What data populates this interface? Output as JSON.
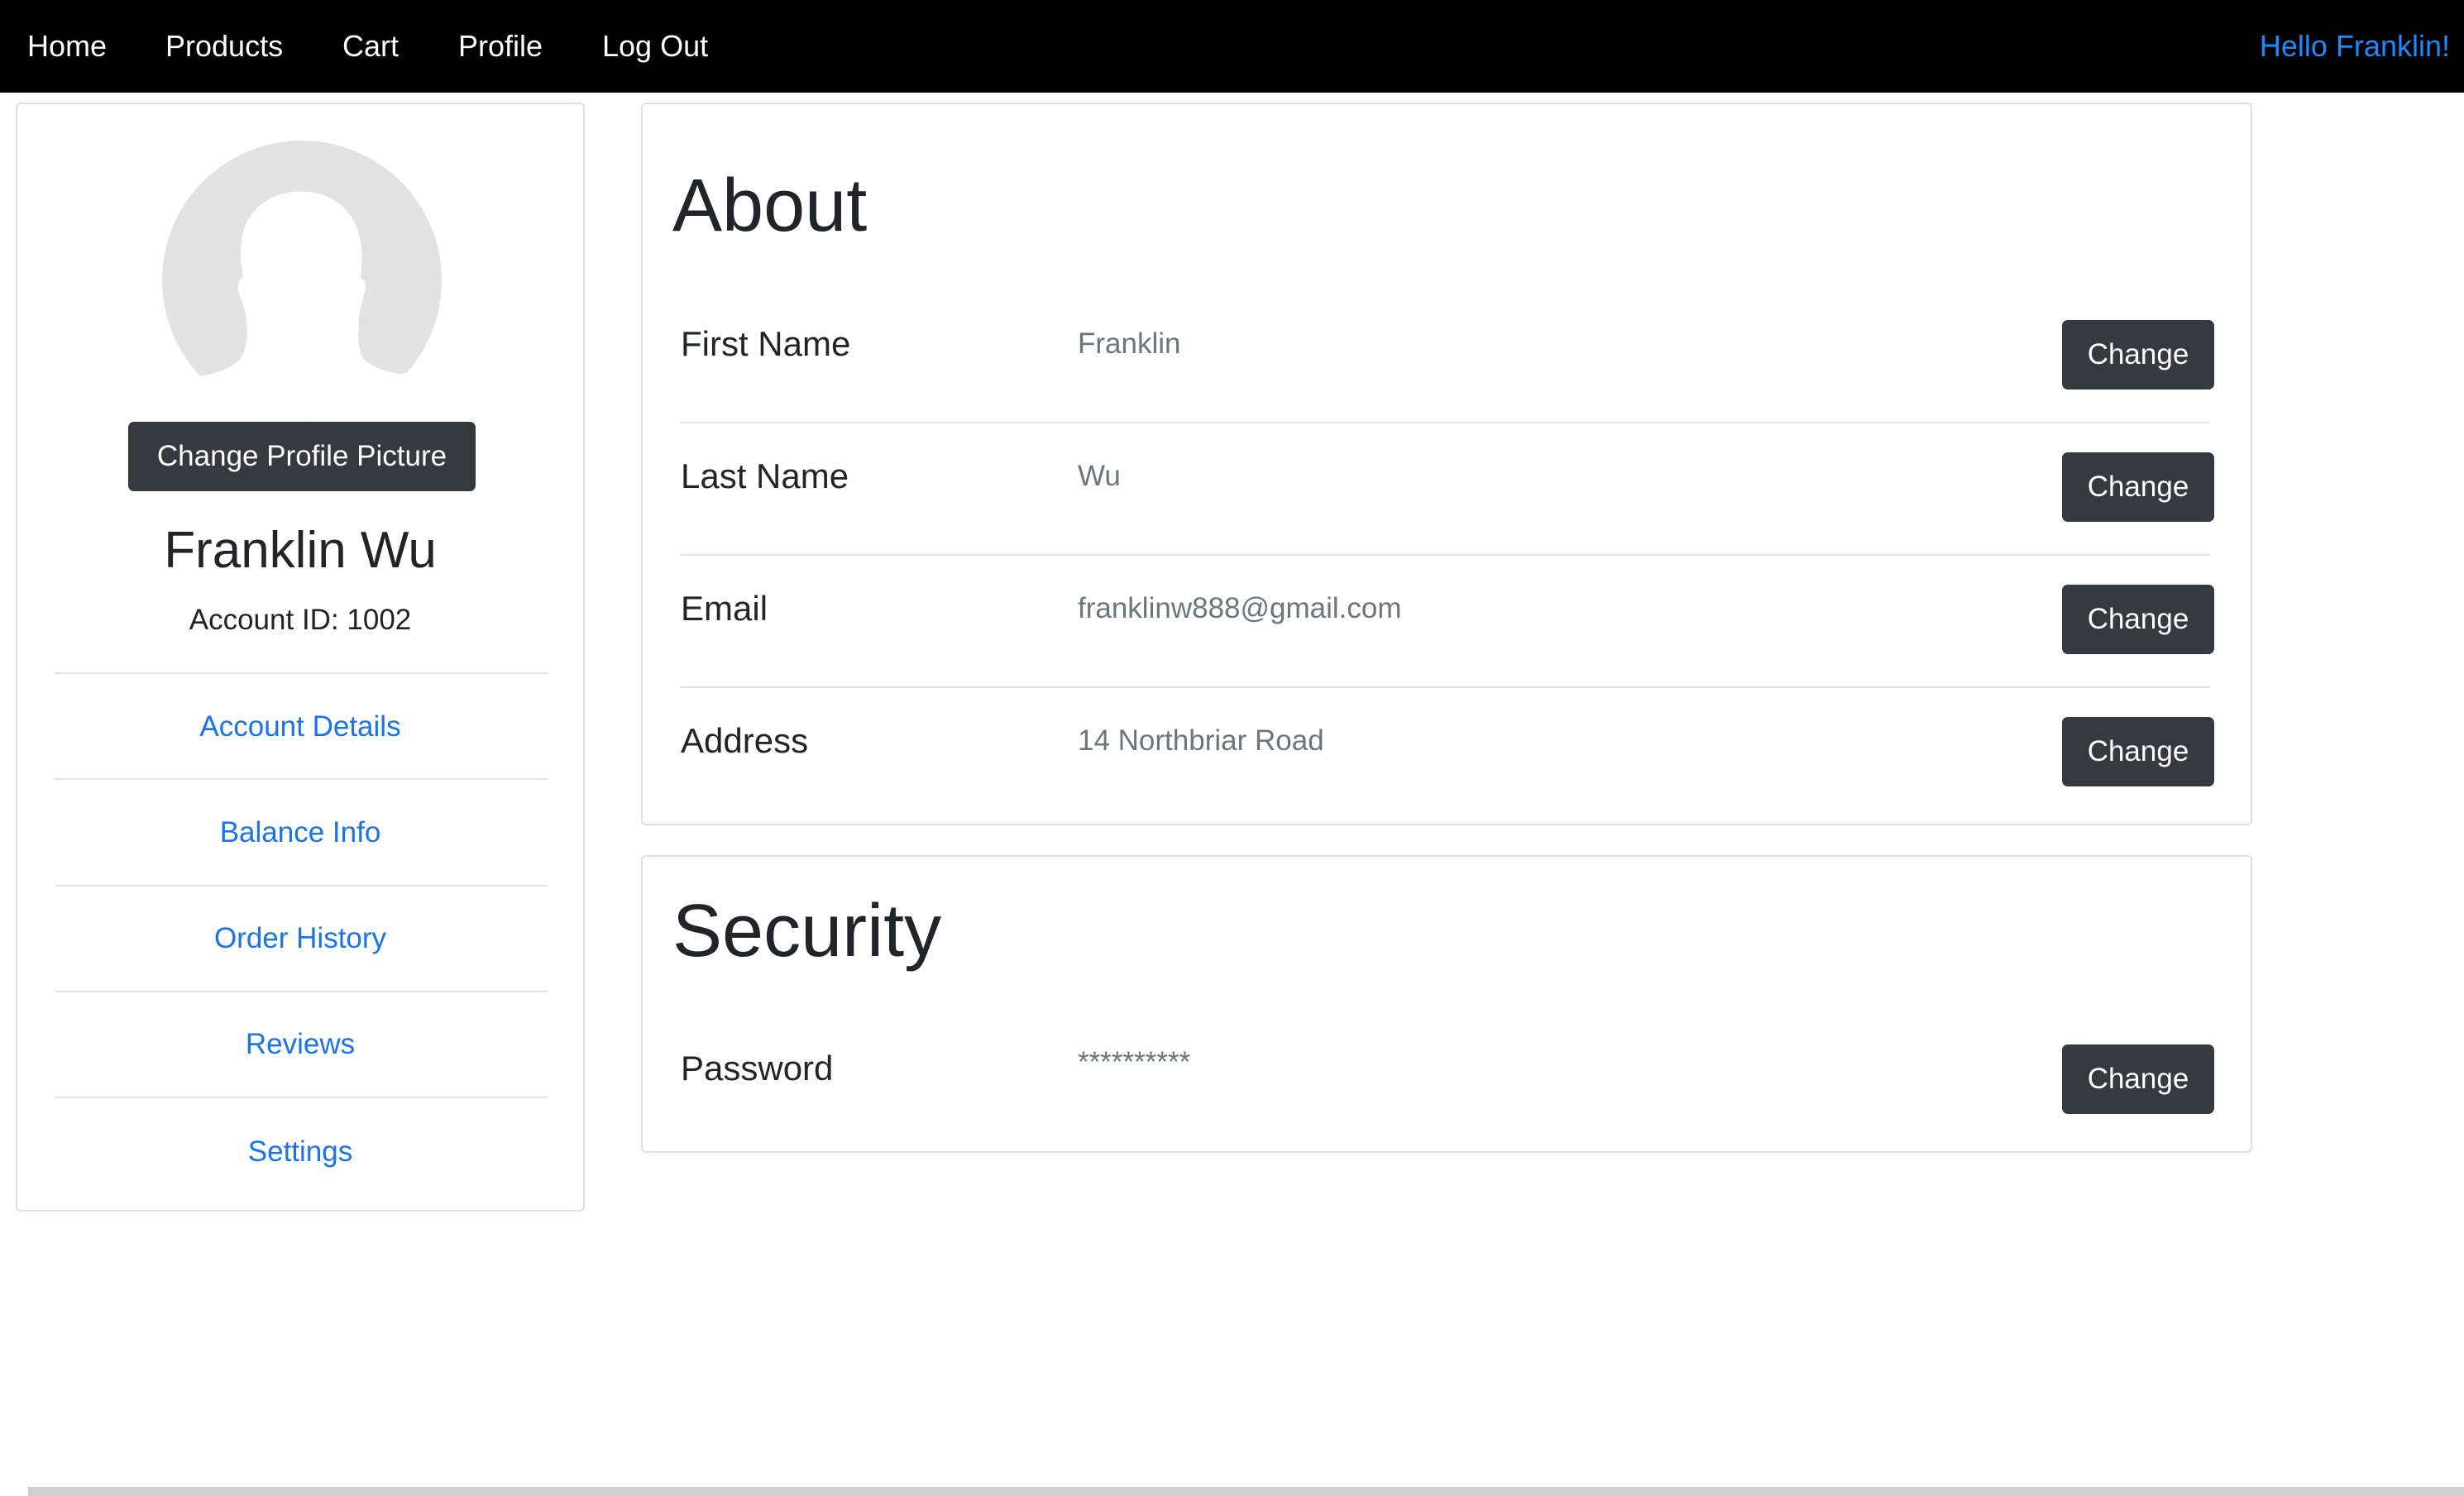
{
  "nav": {
    "items": [
      "Home",
      "Products",
      "Cart",
      "Profile",
      "Log Out"
    ],
    "greeting": "Hello Franklin!"
  },
  "sidebar": {
    "change_picture_label": "Change Profile Picture",
    "full_name": "Franklin Wu",
    "account_id": "Account ID: 1002",
    "links": [
      "Account Details",
      "Balance Info",
      "Order History",
      "Reviews",
      "Settings"
    ]
  },
  "about": {
    "title": "About",
    "fields": [
      {
        "label": "First Name",
        "value": "Franklin",
        "button": "Change"
      },
      {
        "label": "Last Name",
        "value": "Wu",
        "button": "Change"
      },
      {
        "label": "Email",
        "value": "franklinw888@gmail.com",
        "button": "Change"
      },
      {
        "label": "Address",
        "value": "14 Northbriar Road",
        "button": "Change"
      }
    ]
  },
  "security": {
    "title": "Security",
    "fields": [
      {
        "label": "Password",
        "value": "**********",
        "button": "Change"
      }
    ]
  },
  "colors": {
    "navbar": "#000000",
    "link": "#1a73e8",
    "button": "#343a40",
    "avatar_bg": "#e2e2e2"
  }
}
